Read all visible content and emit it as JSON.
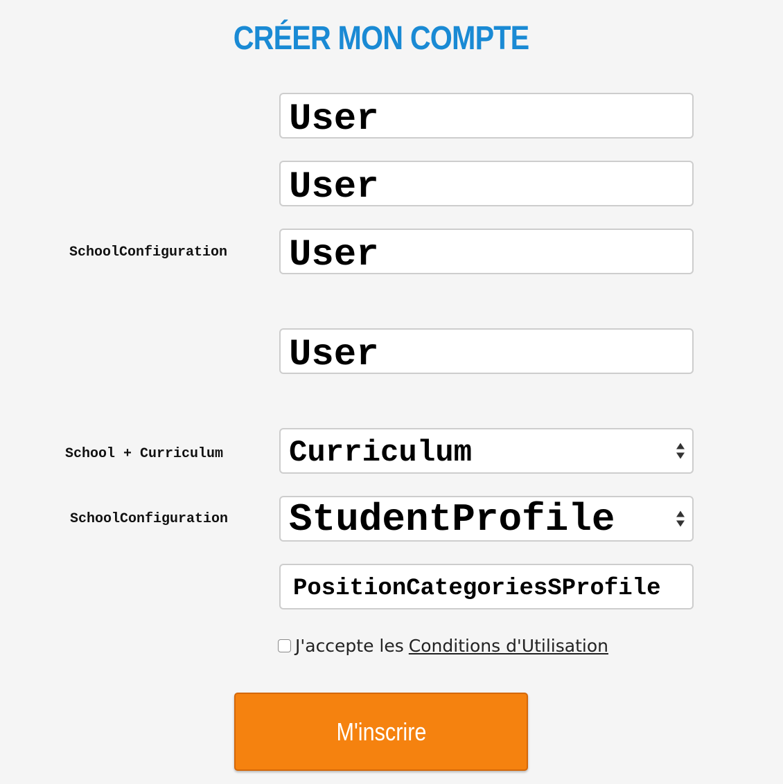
{
  "page": {
    "title": "CRÉER MON COMPTE"
  },
  "fields": [
    {
      "value": "User"
    },
    {
      "value": "User"
    },
    {
      "label": "SchoolConfiguration",
      "value": "User"
    },
    {
      "value": "User"
    },
    {
      "label": "School + Curriculum",
      "value": "Curriculum"
    },
    {
      "label": "SchoolConfiguration",
      "value": "StudentProfile"
    },
    {
      "value": "PositionCategoriesSProfile"
    }
  ],
  "terms": {
    "text": "J'accepte les",
    "link": "Conditions d'Utilisation"
  },
  "submit": {
    "label": "M'inscrire"
  },
  "colors": {
    "title": "#1a8ad4",
    "button": "#f5820f",
    "background": "#f5f5f5"
  }
}
